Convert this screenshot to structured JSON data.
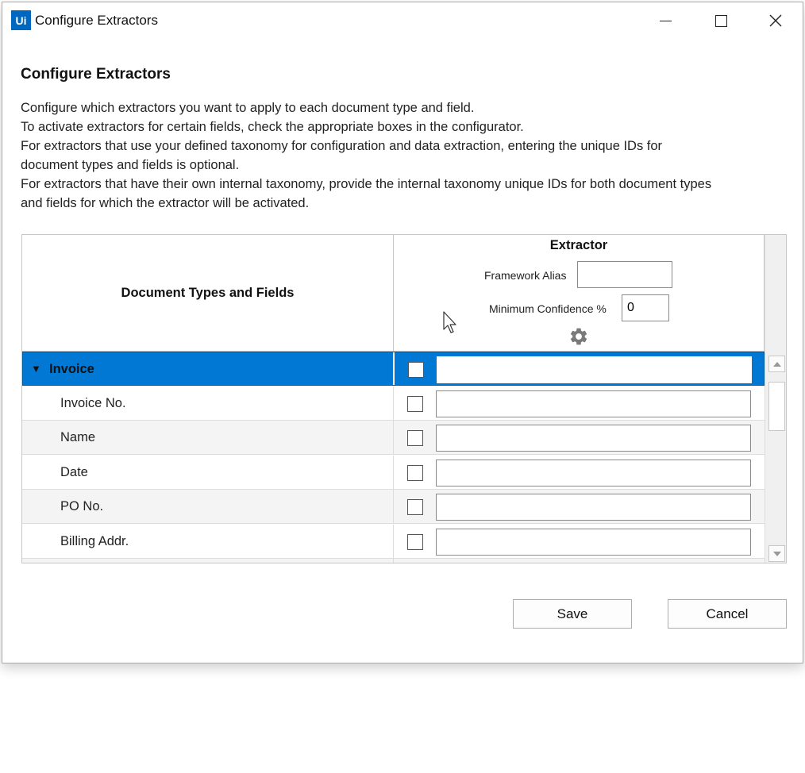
{
  "window": {
    "logo_text": "Ui",
    "title": "Configure Extractors"
  },
  "header": {
    "heading": "Configure Extractors",
    "description_lines": [
      "Configure which extractors you want to apply to each document type and field.",
      "To activate extractors for certain fields, check the appropriate boxes in the configurator.",
      "For extractors that use your defined taxonomy for configuration and data extraction, entering the unique IDs for",
      "document types and fields is optional.",
      "For extractors that have their own internal taxonomy, provide the internal taxonomy unique IDs for both document types",
      "and fields for which the extractor will be activated."
    ]
  },
  "grid": {
    "left_header": "Document Types and Fields",
    "extractor_header": "Extractor",
    "framework_alias_label": "Framework Alias",
    "framework_alias_value": "",
    "min_confidence_label": "Minimum Confidence %",
    "min_confidence_value": "0",
    "settings_icon": "gear-icon",
    "rows": [
      {
        "name": "Invoice",
        "selected": true,
        "expanded": true,
        "checked": false,
        "id": ""
      },
      {
        "name": "Invoice No.",
        "checked": false,
        "id": ""
      },
      {
        "name": "Name",
        "checked": false,
        "id": ""
      },
      {
        "name": "Date",
        "checked": false,
        "id": ""
      },
      {
        "name": "PO No.",
        "checked": false,
        "id": ""
      },
      {
        "name": "Billing Addr.",
        "checked": false,
        "id": ""
      }
    ]
  },
  "buttons": {
    "save": "Save",
    "cancel": "Cancel"
  },
  "colors": {
    "selection": "#0078d4",
    "brand": "#0067c0"
  }
}
